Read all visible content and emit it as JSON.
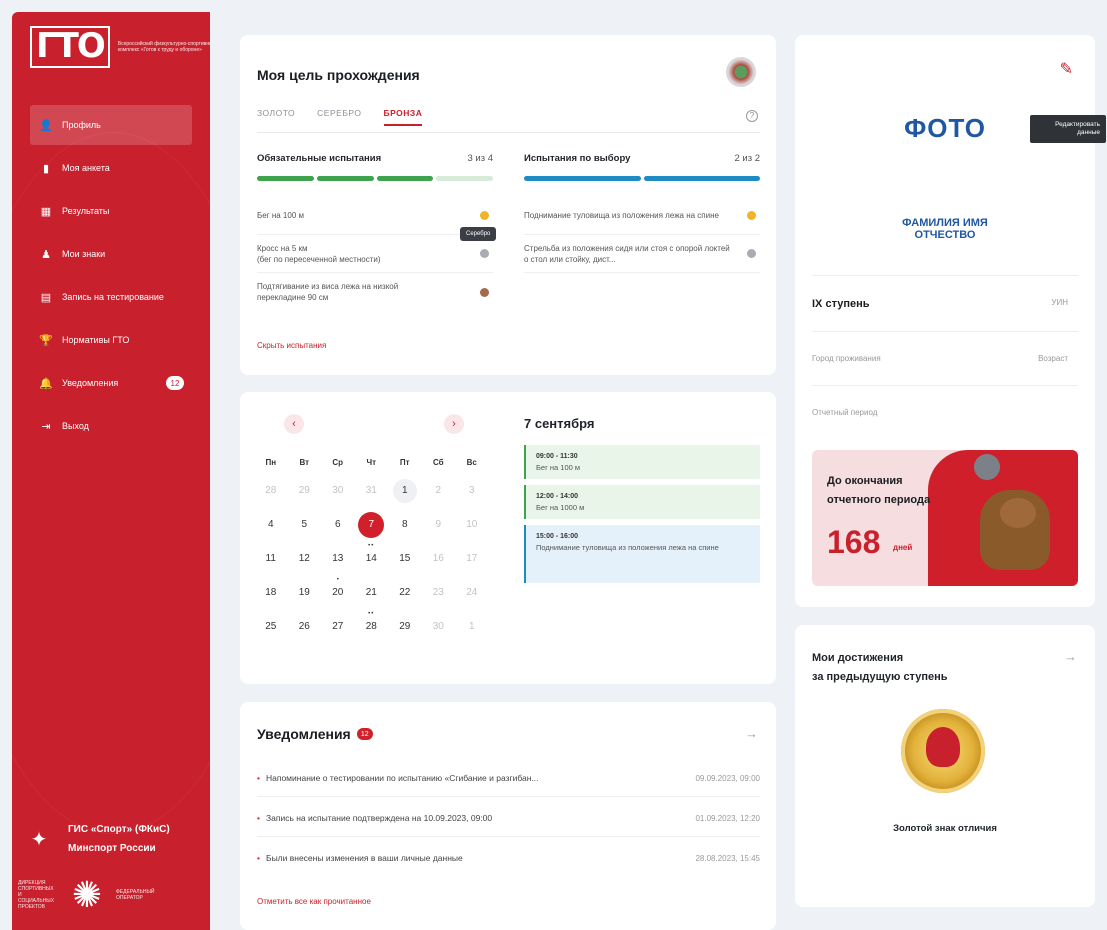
{
  "sidebar": {
    "logo_mark": "ГТО",
    "logo_text": "Всероссийский физкультурно-спортивный комплекс «Готов к труду и обороне»",
    "items": [
      {
        "label": "Профиль",
        "icon": "person-icon",
        "active": true
      },
      {
        "label": "Моя анкета",
        "icon": "document-icon"
      },
      {
        "label": "Результаты",
        "icon": "table-icon"
      },
      {
        "label": "Мои знаки",
        "icon": "medal-icon"
      },
      {
        "label": "Запись на тестирование",
        "icon": "calendar-icon"
      },
      {
        "label": "Нормативы ГТО",
        "icon": "trophy-icon"
      },
      {
        "label": "Уведомления",
        "icon": "bell-icon",
        "badge": "12"
      },
      {
        "label": "Выход",
        "icon": "logout-icon"
      }
    ],
    "footer": {
      "gis_line1": "ГИС «Спорт» (ФКиС)",
      "gis_line2": "Минспорт России",
      "partner_left": "ДИРЕКЦИЯ СПОРТИВНЫХ И СОЦИАЛЬНЫХ ПРОЕКТОВ",
      "partner_right": "ФЕДЕРАЛЬНЫЙ ОПЕРАТОР"
    }
  },
  "goal": {
    "title": "Моя цель прохождения",
    "tabs": [
      "ЗОЛОТО",
      "СЕРЕБРО",
      "БРОНЗА"
    ],
    "active_tab": "БРОНЗА",
    "mandatory": {
      "title": "Обязательные испытания",
      "count": "3 из 4",
      "tests": [
        {
          "text": "Бег на 100 м",
          "color": "#f0b428"
        },
        {
          "text": "Кросс на 5 км\n(бег по пересеченной местности)",
          "color": "#a9adb3"
        },
        {
          "text": "Подтягивание из виса лежа на низкой перекладине 90 см",
          "color": "#a36a4e"
        }
      ]
    },
    "optional": {
      "title": "Испытания по выбору",
      "count": "2 из 2",
      "tests": [
        {
          "text": "Поднимание туловища из положения лежа на спине",
          "color": "#f0b428"
        },
        {
          "text": "Стрельба из положения сидя или стоя с опорой локтей о стол или стойку, дист...",
          "color": "#a9adb3"
        }
      ]
    },
    "tooltip": "Серебро",
    "hide_link": "Скрыть испытания",
    "colors": {
      "green": "#3fa34d",
      "green_light": "#d6ecd8",
      "blue": "#1f8bc4"
    }
  },
  "calendar": {
    "weekdays": [
      "Пн",
      "Вт",
      "Ср",
      "Чт",
      "Пт",
      "Сб",
      "Вс"
    ],
    "days": [
      [
        "28",
        "29",
        "30",
        "31",
        "1",
        "2",
        "3"
      ],
      [
        "4",
        "5",
        "6",
        "7",
        "8",
        "9",
        "10"
      ],
      [
        "11",
        "12",
        "13",
        "14",
        "15",
        "16",
        "17"
      ],
      [
        "18",
        "19",
        "20",
        "21",
        "22",
        "23",
        "24"
      ],
      [
        "25",
        "26",
        "27",
        "28",
        "29",
        "30",
        "1"
      ]
    ],
    "selected_date": "7 сентября",
    "events": [
      {
        "time": "09:00 - 11:30",
        "title": "Бег на 100 м",
        "color": "#3fa34d",
        "bg": "#eaf5ea"
      },
      {
        "time": "12:00 - 14:00",
        "title": "Бег на 1000 м",
        "color": "#3fa34d",
        "bg": "#eaf5ea"
      },
      {
        "time": "15:00 - 16:00",
        "title": "Поднимание туловища из положения лежа на спине",
        "color": "#1f8bc4",
        "bg": "#e5f1fa"
      }
    ]
  },
  "notifications": {
    "title": "Уведомления",
    "badge": "12",
    "items": [
      {
        "text": "Напоминание о тестировании по испытанию «Сгибание и разгибан...",
        "time": "09.09.2023, 09:00"
      },
      {
        "text": "Запись на испытание подтверждена на 10.09.2023, 09:00",
        "time": "01.09.2023, 12:20"
      },
      {
        "text": "Были внесены изменения в ваши личные данные",
        "time": "28.08.2023, 15:45"
      }
    ],
    "mark_all": "Отметить все как прочитанное"
  },
  "profile": {
    "photo": "ФОТО",
    "fio_line1": "ФАМИЛИЯ ИМЯ",
    "fio_line2": "ОТЧЕСТВО",
    "edit_tooltip": "Редактировать данные",
    "rows": [
      {
        "label": "IX ступень",
        "value": "УИН"
      },
      {
        "label": "Город проживания",
        "value": "Возраст"
      },
      {
        "label": "Отчетный период",
        "value": ""
      }
    ],
    "period_line1": "До окончания",
    "period_line2": "отчетного периода",
    "period_days": "168",
    "period_unit": "дней"
  },
  "achievements": {
    "title_line1": "Мои достижения",
    "title_line2": "за предыдущую ступень",
    "badge_name": "Золотой знак отличия"
  }
}
